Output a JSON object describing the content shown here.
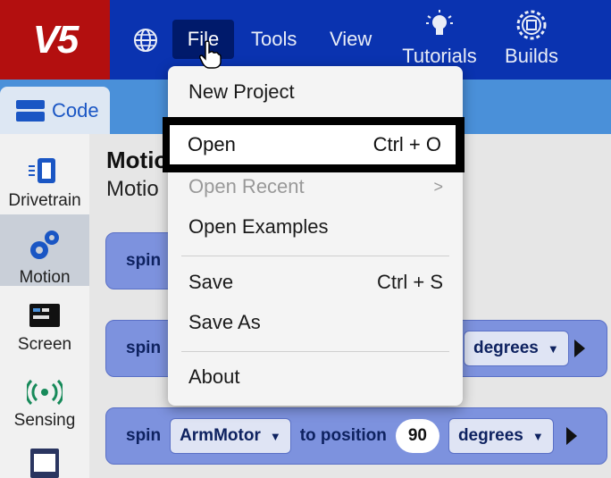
{
  "app": {
    "logo_text": "V5"
  },
  "topbar": {
    "menus": [
      {
        "label": "File"
      },
      {
        "label": "Tools"
      },
      {
        "label": "View"
      }
    ],
    "tutorials_label": "Tutorials",
    "builds_label": "Builds"
  },
  "code_tab_label": "Code",
  "sidebar": {
    "categories": [
      {
        "label": "Drivetrain",
        "icon": "drivetrain-icon"
      },
      {
        "label": "Motion",
        "icon": "gears-icon",
        "active": true
      },
      {
        "label": "Screen",
        "icon": "screen-icon"
      },
      {
        "label": "Sensing",
        "icon": "sensing-icon"
      }
    ]
  },
  "workspace": {
    "heading": "Motio",
    "subheading": "Motio",
    "blocks": [
      {
        "keyword": "spin"
      },
      {
        "keyword": "spin",
        "units": "degrees"
      },
      {
        "keyword": "spin",
        "motor": "ArmMotor",
        "action": "to position",
        "value": "90",
        "units": "degrees"
      }
    ]
  },
  "file_menu": {
    "items": [
      {
        "label": "New Project",
        "shortcut": ""
      },
      {
        "label": "Open",
        "shortcut": "Ctrl + O",
        "highlighted": true
      },
      {
        "label": "Open Recent",
        "shortcut": ">",
        "disabled": true
      },
      {
        "label": "Open Examples",
        "shortcut": ""
      },
      {
        "label": "Save",
        "shortcut": "Ctrl + S"
      },
      {
        "label": "Save As",
        "shortcut": ""
      },
      {
        "label": "About",
        "shortcut": ""
      }
    ]
  },
  "colors": {
    "topbar": "#0a33b0",
    "logo_bg": "#b30f0f",
    "block": "#7d92de",
    "accent": "#1a56c4"
  }
}
